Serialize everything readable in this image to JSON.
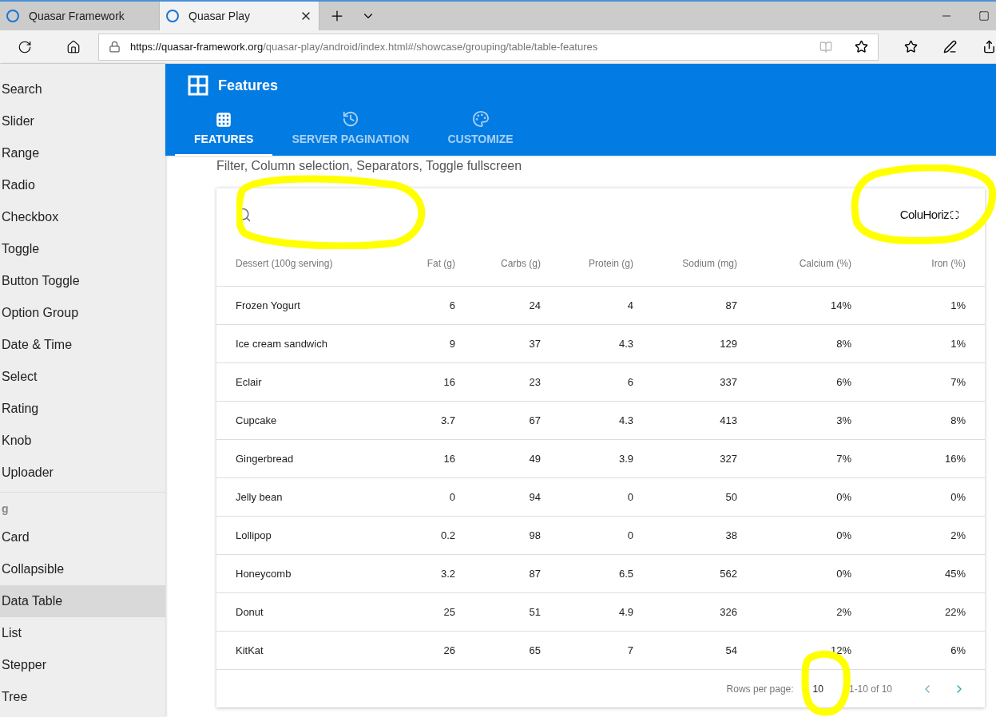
{
  "browser": {
    "tabs": [
      {
        "title": "Quasar Framework",
        "selected": false
      },
      {
        "title": "Quasar Play",
        "selected": true
      }
    ],
    "url_host": "https://quasar-framework.org",
    "url_path": "/quasar-play/android/index.html#/showcase/grouping/table/table-features"
  },
  "sidebar": {
    "items": [
      {
        "label": "Search",
        "selected": false
      },
      {
        "label": "Slider",
        "selected": false
      },
      {
        "label": "Range",
        "selected": false
      },
      {
        "label": "Radio",
        "selected": false
      },
      {
        "label": "Checkbox",
        "selected": false
      },
      {
        "label": "Toggle",
        "selected": false
      },
      {
        "label": "Button Toggle",
        "selected": false
      },
      {
        "label": "Option Group",
        "selected": false
      },
      {
        "label": "Date & Time",
        "selected": false
      },
      {
        "label": "Select",
        "selected": false
      },
      {
        "label": "Rating",
        "selected": false
      },
      {
        "label": "Knob",
        "selected": false
      },
      {
        "label": "Uploader",
        "selected": false
      }
    ],
    "section": "g",
    "items2": [
      {
        "label": "Card",
        "selected": false
      },
      {
        "label": "Collapsible",
        "selected": false
      },
      {
        "label": "Data Table",
        "selected": true
      },
      {
        "label": "List",
        "selected": false
      },
      {
        "label": "Stepper",
        "selected": false
      },
      {
        "label": "Tree",
        "selected": false
      }
    ]
  },
  "header": {
    "title": "Features",
    "tabs": [
      {
        "label": "FEATURES",
        "kind": "grid",
        "selected": true
      },
      {
        "label": "SERVER PAGINATION",
        "kind": "history",
        "selected": false
      },
      {
        "label": "CUSTOMIZE",
        "kind": "palette",
        "selected": false
      }
    ]
  },
  "description": "Filter, Column selection, Separators, Toggle fullscreen",
  "table": {
    "toolbar_text": "ColuHoriz",
    "columns": [
      "Dessert (100g serving)",
      "Fat (g)",
      "Carbs (g)",
      "Protein (g)",
      "Sodium (mg)",
      "Calcium (%)",
      "Iron (%)"
    ],
    "rows": [
      [
        "Frozen Yogurt",
        "6",
        "24",
        "4",
        "87",
        "14%",
        "1%"
      ],
      [
        "Ice cream sandwich",
        "9",
        "37",
        "4.3",
        "129",
        "8%",
        "1%"
      ],
      [
        "Eclair",
        "16",
        "23",
        "6",
        "337",
        "6%",
        "7%"
      ],
      [
        "Cupcake",
        "3.7",
        "67",
        "4.3",
        "413",
        "3%",
        "8%"
      ],
      [
        "Gingerbread",
        "16",
        "49",
        "3.9",
        "327",
        "7%",
        "16%"
      ],
      [
        "Jelly bean",
        "0",
        "94",
        "0",
        "50",
        "0%",
        "0%"
      ],
      [
        "Lollipop",
        "0.2",
        "98",
        "0",
        "38",
        "0%",
        "2%"
      ],
      [
        "Honeycomb",
        "3.2",
        "87",
        "6.5",
        "562",
        "0%",
        "45%"
      ],
      [
        "Donut",
        "25",
        "51",
        "4.9",
        "326",
        "2%",
        "22%"
      ],
      [
        "KitKat",
        "26",
        "65",
        "7",
        "54",
        "12%",
        "6%"
      ]
    ],
    "pagination": {
      "rows_label": "Rows per page:",
      "rows_value": "10",
      "range": "1-10 of 10"
    }
  }
}
